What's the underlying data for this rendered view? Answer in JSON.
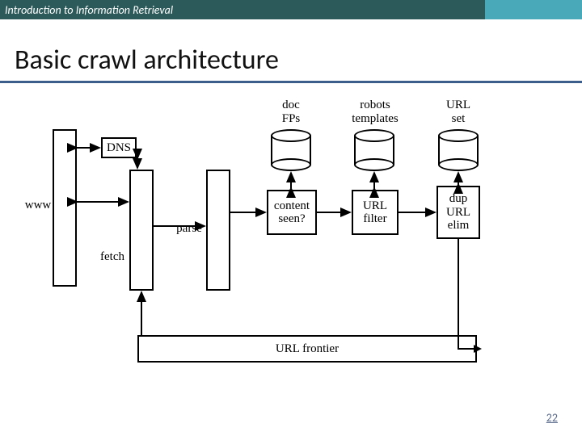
{
  "header": {
    "course": "Introduction to Information Retrieval"
  },
  "slide": {
    "title": "Basic crawl architecture",
    "page_number": "22"
  },
  "diagram": {
    "labels": {
      "www": "www",
      "dns": "DNS",
      "fetch": "fetch",
      "parse": "parse",
      "content_seen": "content\nseen?",
      "url_filter": "URL\nfilter",
      "dup_url_elim": "dup\nURL\nelim",
      "url_frontier": "URL frontier",
      "doc_fps": "doc\nFPs",
      "robots_templates": "robots\ntemplates",
      "url_set": "URL\nset"
    }
  },
  "chart_data": {
    "type": "diagram",
    "title": "Basic crawl architecture",
    "nodes": [
      {
        "id": "www",
        "label": "www",
        "kind": "external"
      },
      {
        "id": "dns",
        "label": "DNS",
        "kind": "module"
      },
      {
        "id": "fetch",
        "label": "fetch",
        "kind": "module"
      },
      {
        "id": "parse",
        "label": "parse",
        "kind": "module"
      },
      {
        "id": "content_seen",
        "label": "content seen?",
        "kind": "module"
      },
      {
        "id": "url_filter",
        "label": "URL filter",
        "kind": "module"
      },
      {
        "id": "dup_url_elim",
        "label": "dup URL elim",
        "kind": "module"
      },
      {
        "id": "url_frontier",
        "label": "URL frontier",
        "kind": "module"
      },
      {
        "id": "doc_fps",
        "label": "doc FPs",
        "kind": "store"
      },
      {
        "id": "robots_templates",
        "label": "robots templates",
        "kind": "store"
      },
      {
        "id": "url_set",
        "label": "URL set",
        "kind": "store"
      }
    ],
    "edges": [
      {
        "from": "www",
        "to": "dns",
        "bidirectional": true
      },
      {
        "from": "www",
        "to": "fetch",
        "bidirectional": true
      },
      {
        "from": "dns",
        "to": "fetch",
        "bidirectional": true
      },
      {
        "from": "fetch",
        "to": "parse",
        "bidirectional": false
      },
      {
        "from": "parse",
        "to": "content_seen",
        "bidirectional": false
      },
      {
        "from": "content_seen",
        "to": "url_filter",
        "bidirectional": false
      },
      {
        "from": "url_filter",
        "to": "dup_url_elim",
        "bidirectional": false
      },
      {
        "from": "content_seen",
        "to": "doc_fps",
        "bidirectional": true
      },
      {
        "from": "url_filter",
        "to": "robots_templates",
        "bidirectional": true
      },
      {
        "from": "dup_url_elim",
        "to": "url_set",
        "bidirectional": true
      },
      {
        "from": "dup_url_elim",
        "to": "url_frontier",
        "bidirectional": false
      },
      {
        "from": "url_frontier",
        "to": "fetch",
        "bidirectional": false
      }
    ]
  }
}
